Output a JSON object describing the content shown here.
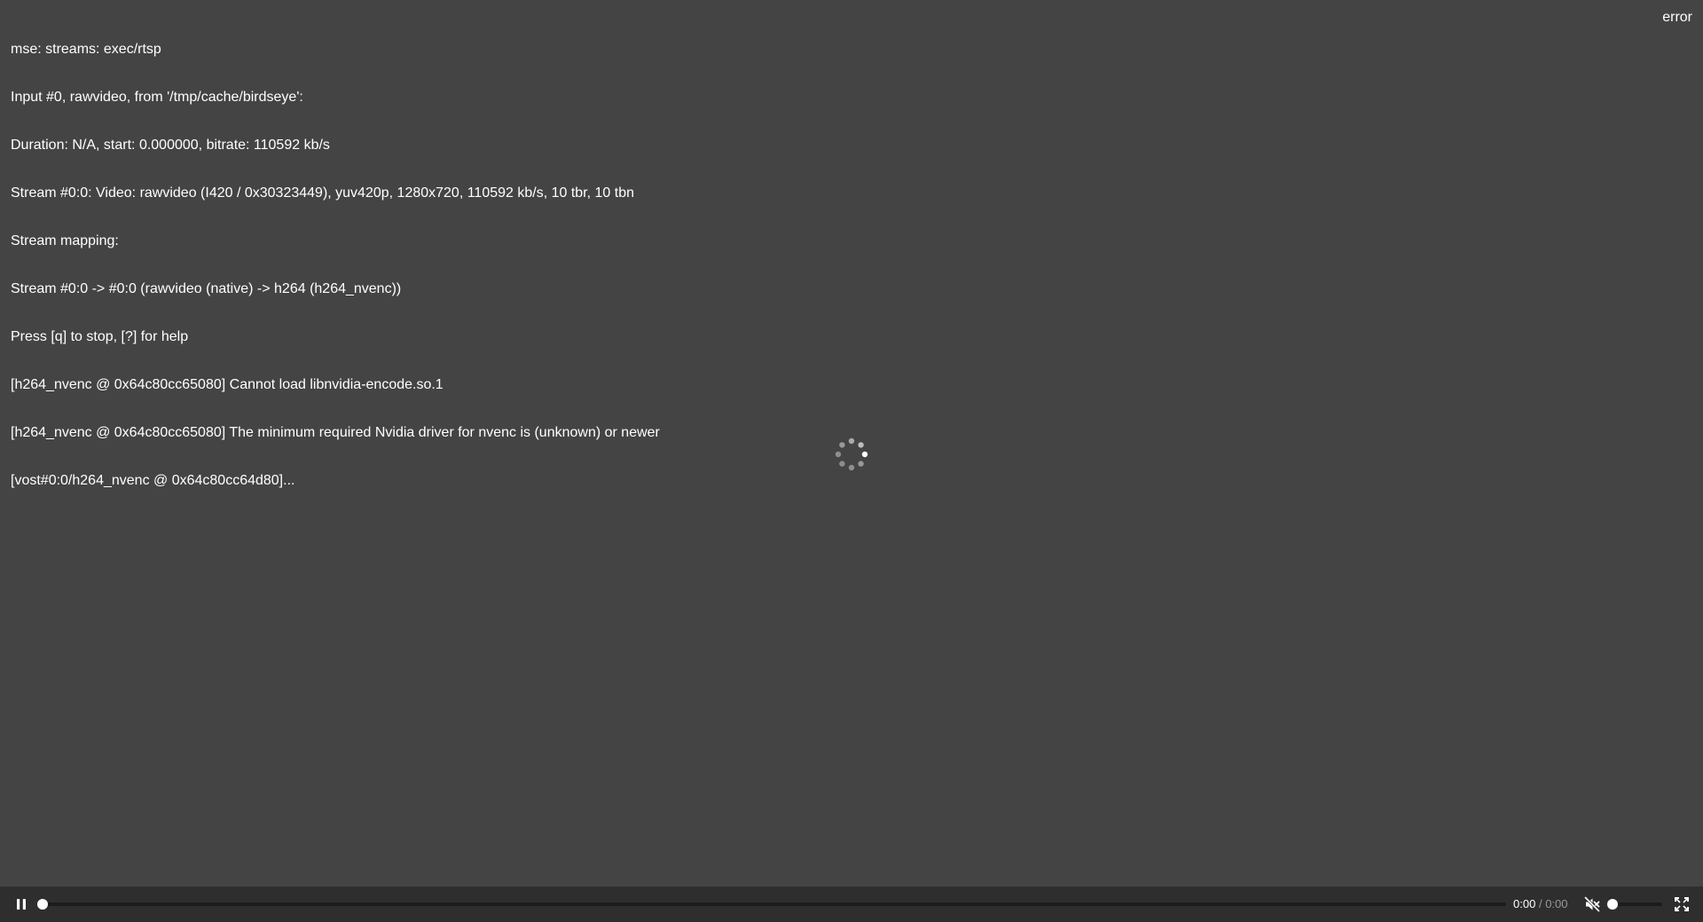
{
  "log_lines": [
    "mse: streams: exec/rtsp",
    "Input #0, rawvideo, from '/tmp/cache/birdseye':",
    "Duration: N/A, start: 0.000000, bitrate: 110592 kb/s",
    "Stream #0:0: Video: rawvideo (I420 / 0x30323449), yuv420p, 1280x720, 110592 kb/s, 10 tbr, 10 tbn",
    "Stream mapping:",
    "Stream #0:0 -> #0:0 (rawvideo (native) -> h264 (h264_nvenc))",
    "Press [q] to stop, [?] for help",
    "[h264_nvenc @ 0x64c80cc65080] Cannot load libnvidia-encode.so.1",
    "[h264_nvenc @ 0x64c80cc65080] The minimum required Nvidia driver for nvenc is (unknown) or newer",
    "[vost#0:0/h264_nvenc @ 0x64c80cc64d80]..."
  ],
  "status": "error",
  "player": {
    "current_time": "0:00",
    "separator": "/",
    "duration": "0:00",
    "progress": 0,
    "volume_level": 0,
    "muted": true,
    "icons": {
      "play_pause": "pause-icon",
      "mute": "speaker-muted-icon",
      "fullscreen": "fullscreen-icon",
      "loading": "loading-spinner-icon"
    }
  },
  "colors": {
    "background": "#444444",
    "control_bar": "#2e2e2e",
    "text": "#ffffff"
  }
}
